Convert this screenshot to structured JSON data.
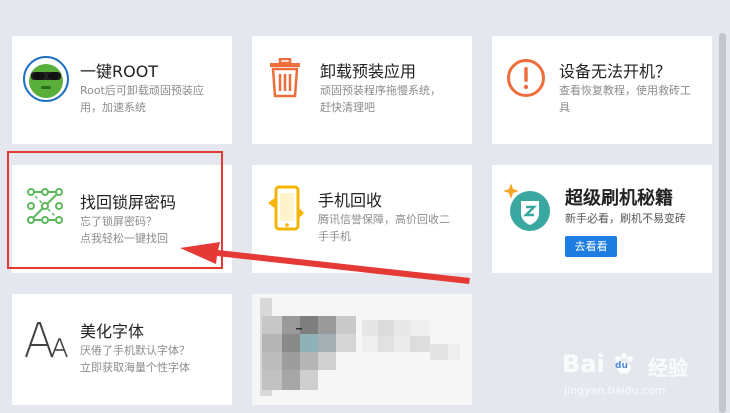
{
  "cards": [
    {
      "title": "一键ROOT",
      "desc_line1": "Root后可卸载顽固预装应",
      "desc_line2": "用，加速系统",
      "icon": "root-mascot-icon"
    },
    {
      "title": "卸载预装应用",
      "desc_line1": "顽固预装程序拖慢系统，",
      "desc_line2": "赶快清理吧",
      "icon": "trash-icon"
    },
    {
      "title": "设备无法开机？",
      "desc_line1": "查看恢复教程，使用救砖工",
      "desc_line2": "具",
      "icon": "warning-icon"
    },
    {
      "title": "找回锁屏密码",
      "desc_line1": "忘了锁屏密码？",
      "desc_line2": "点我轻松一键找回",
      "icon": "pattern-lock-icon"
    },
    {
      "title": "手机回收",
      "desc_line1": "腾讯信誉保障，高价回收二",
      "desc_line2": "手手机",
      "icon": "phone-recycle-icon"
    },
    {
      "title": "超级刷机秘籍",
      "desc_line1": "新手必看，刷机不易变砖",
      "button": "去看看",
      "icon": "shield-sparkle-icon"
    },
    {
      "title": "美化字体",
      "desc_line1": "厌倦了手机默认字体？",
      "desc_line2": "立即获取海量个性字体",
      "icon": "font-aa-icon"
    }
  ],
  "watermark": {
    "brand": "Bai",
    "paw": "du",
    "product": "经验",
    "url": "jingyan.baidu.com"
  },
  "colors": {
    "accent_orange": "#ee6d3a",
    "pattern_green": "#5cb85c",
    "highlight_red": "#e53935",
    "button_blue": "#1e7de0",
    "shield_teal": "#3aa8a0"
  }
}
